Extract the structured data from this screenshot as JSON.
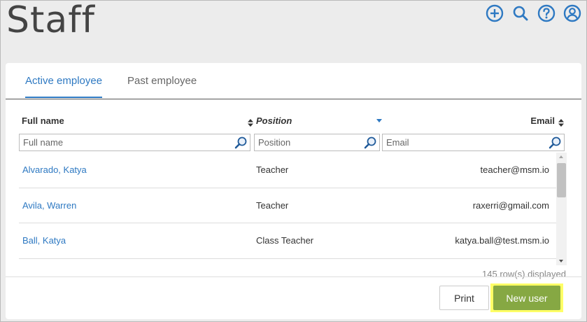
{
  "page": {
    "title": "Staff"
  },
  "header_icons": [
    "add-icon",
    "search-icon",
    "help-icon",
    "user-icon"
  ],
  "tabs": [
    {
      "label": "Active employee",
      "active": true
    },
    {
      "label": "Past employee",
      "active": false
    }
  ],
  "table": {
    "columns": [
      {
        "label": "Full name",
        "placeholder": "Full name"
      },
      {
        "label": "Position",
        "placeholder": "Position"
      },
      {
        "label": "Email",
        "placeholder": "Email"
      }
    ],
    "rows": [
      {
        "name": "Alvarado, Katya",
        "position": "Teacher",
        "email": "teacher@msm.io"
      },
      {
        "name": "Avila, Warren",
        "position": "Teacher",
        "email": "raxerri@gmail.com"
      },
      {
        "name": "Ball, Katya",
        "position": "Class Teacher",
        "email": "katya.ball@test.msm.io"
      }
    ],
    "rows_displayed": "145 row(s) displayed"
  },
  "buttons": {
    "print": "Print",
    "new_user": "New user"
  },
  "colors": {
    "accent": "#2e79c2",
    "primary_button": "#86a843",
    "highlight": "#ffff66"
  }
}
